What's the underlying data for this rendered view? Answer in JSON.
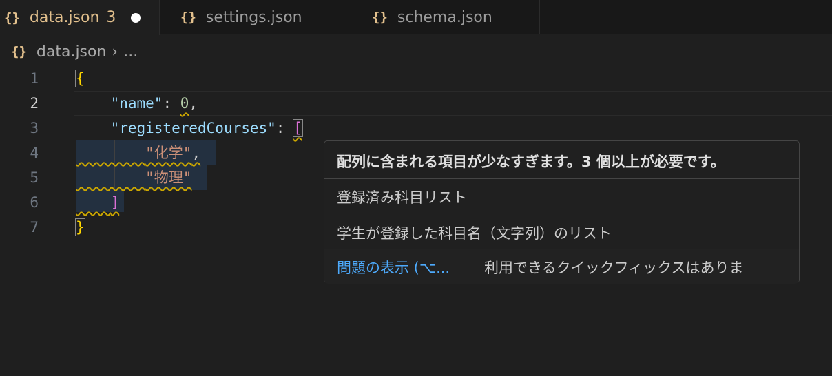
{
  "tabs": [
    {
      "label": "data.json",
      "count": "3",
      "icon": "{}"
    },
    {
      "label": "settings.json",
      "icon": "{}"
    },
    {
      "label": "schema.json",
      "icon": "{}"
    }
  ],
  "breadcrumb": {
    "icon": "{}",
    "file": "data.json",
    "separator": "›",
    "more": "..."
  },
  "line_numbers": [
    "1",
    "2",
    "3",
    "4",
    "5",
    "6",
    "7"
  ],
  "code": {
    "open_brace": "{",
    "name_key": "\"name\"",
    "colon": ":",
    "name_value": "0",
    "comma": ",",
    "courses_key": "\"registeredCourses\"",
    "open_bracket": "[",
    "item1": "\"化学\"",
    "item2": "\"物理\"",
    "close_bracket": "]",
    "close_brace": "}"
  },
  "hover": {
    "problem": "配列に含まれる項目が少なすぎます。3 個以上が必要です。",
    "title": "登録済み科目リスト",
    "description": "学生が登録した科目名（文字列）のリスト",
    "view_problem": "問題の表示 (⌥...",
    "no_quick_fix": "利用できるクイックフィックスはありま"
  },
  "colors": {
    "warning": "#cca700",
    "link": "#4daafc",
    "tab_active_text": "#e2c08d"
  }
}
